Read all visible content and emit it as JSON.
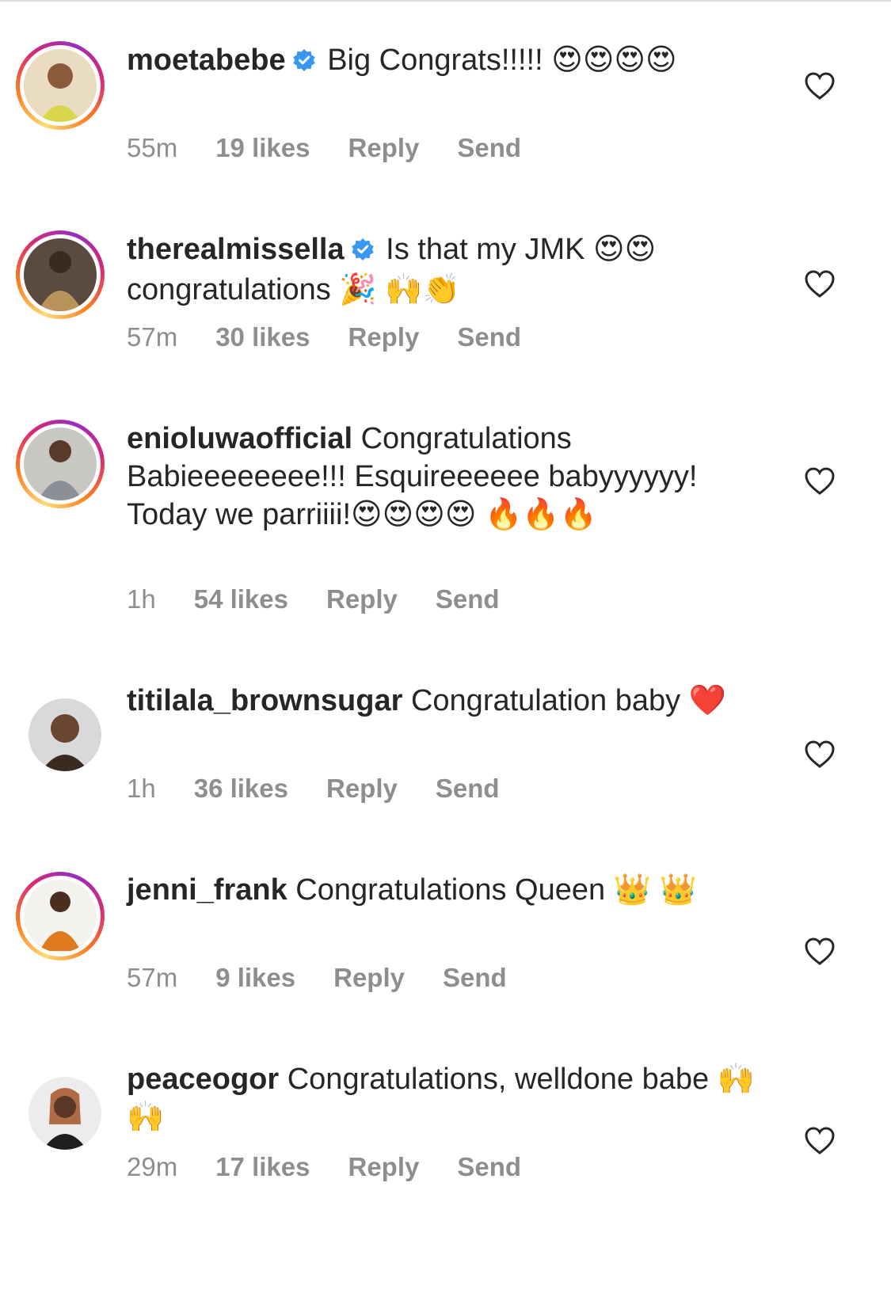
{
  "comments": [
    {
      "username": "moetabebe",
      "verified": true,
      "text": "Big Congrats!!!!! 😍😍😍😍",
      "time": "55m",
      "likes": "19 likes",
      "reply": "Reply",
      "send": "Send"
    },
    {
      "username": "therealmissella",
      "verified": true,
      "text": "Is that my JMK 😍😍 congratulations 🎉 🙌👏",
      "time": "57m",
      "likes": "30 likes",
      "reply": "Reply",
      "send": "Send"
    },
    {
      "username": "enioluwaofficial",
      "verified": false,
      "text": "Congratulations Babieeeeeeee!!! Esquireeeeee babyyyyyy! Today we parriiii!😍😍😍😍 🔥🔥🔥",
      "time": "1h",
      "likes": "54 likes",
      "reply": "Reply",
      "send": "Send"
    },
    {
      "username": "titilala_brownsugar",
      "verified": false,
      "text": "Congratulation baby ❤️",
      "time": "1h",
      "likes": "36 likes",
      "reply": "Reply",
      "send": "Send"
    },
    {
      "username": "jenni_frank",
      "verified": false,
      "text": "Congratulations Queen 👑 👑",
      "time": "57m",
      "likes": "9 likes",
      "reply": "Reply",
      "send": "Send"
    },
    {
      "username": "peaceogor",
      "verified": false,
      "text": "Congratulations, welldone babe 🙌🙌",
      "time": "29m",
      "likes": "17 likes",
      "reply": "Reply",
      "send": "Send"
    }
  ],
  "colors": {
    "text": "#262626",
    "meta": "#8e8e8e",
    "verified": "#3897f0"
  }
}
